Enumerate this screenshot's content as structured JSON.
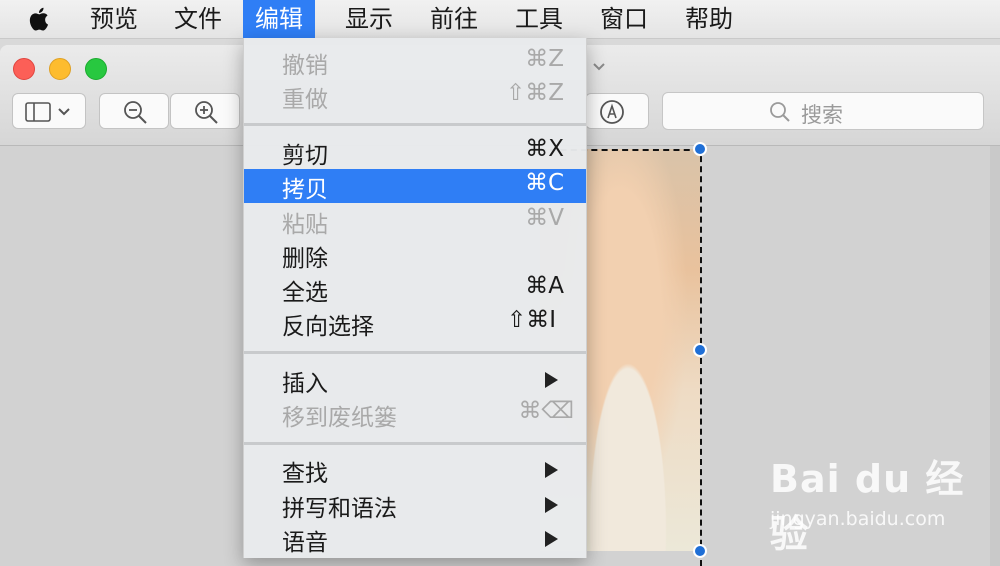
{
  "menubar": {
    "apple_icon": "apple-logo-icon",
    "items": [
      {
        "label": "预览"
      },
      {
        "label": "文件"
      },
      {
        "label": "编辑"
      },
      {
        "label": "显示"
      },
      {
        "label": "前往"
      },
      {
        "label": "工具"
      },
      {
        "label": "窗口"
      },
      {
        "label": "帮助"
      }
    ],
    "active_index": 2,
    "active_color": "#2f7ef5"
  },
  "toolbar": {
    "sidebar_icon": "sidebar-toggle-icon",
    "zoom_out_icon": "zoom-out-icon",
    "zoom_in_icon": "zoom-in-icon",
    "markup_icon": "markup-pen-icon",
    "search_placeholder": "搜索"
  },
  "edit_menu": {
    "items": [
      {
        "label": "撤销",
        "shortcut": "⌘Z",
        "enabled": false
      },
      {
        "label": "重做",
        "shortcut": "⇧⌘Z",
        "enabled": false
      },
      {
        "label": "剪切",
        "shortcut": "⌘X",
        "enabled": true
      },
      {
        "label": "拷贝",
        "shortcut": "⌘C",
        "enabled": true,
        "selected": true
      },
      {
        "label": "粘贴",
        "shortcut": "⌘V",
        "enabled": false
      },
      {
        "label": "删除",
        "shortcut": "",
        "enabled": true
      },
      {
        "label": "全选",
        "shortcut": "⌘A",
        "enabled": true
      },
      {
        "label": "反向选择",
        "shortcut": "⇧⌘I",
        "enabled": true
      },
      {
        "label": "插入",
        "shortcut": "",
        "submenu": true,
        "enabled": true
      },
      {
        "label": "移到废纸篓",
        "shortcut": "⌘⌫",
        "enabled": false
      },
      {
        "label": "查找",
        "shortcut": "",
        "submenu": true,
        "enabled": true
      },
      {
        "label": "拼写和语法",
        "shortcut": "",
        "submenu": true,
        "enabled": true
      },
      {
        "label": "语音",
        "shortcut": "",
        "submenu": true,
        "enabled": true
      }
    ]
  },
  "watermark": {
    "brand": "Bai du 经验",
    "url": "jingyan.baidu.com"
  }
}
